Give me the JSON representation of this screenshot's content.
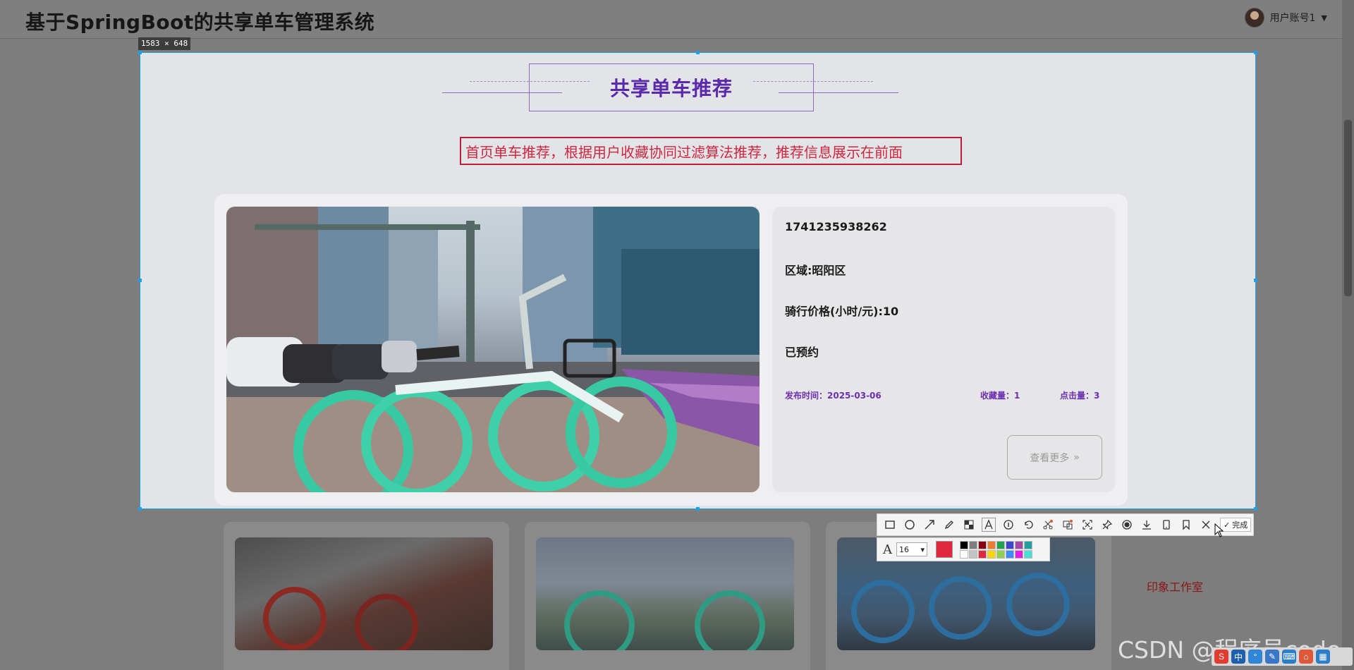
{
  "site": {
    "title": "基于SpringBoot的共享单车管理系统",
    "user_label": "用户账号1",
    "caret": "▼"
  },
  "capture": {
    "size_label": "1583 × 648"
  },
  "recommend": {
    "title": "共享单车推荐",
    "description": "首页单车推荐，根据用户收藏协同过滤算法推荐，推荐信息展示在前面"
  },
  "featured_bike": {
    "id": "1741235938262",
    "region": "区域:昭阳区",
    "price": "骑行价格(小时/元):10",
    "status": "已预约",
    "publish_time": "发布时间：2025-03-06",
    "favorites": "收藏量：1",
    "clicks": "点击量：3",
    "more_label": "查看更多",
    "more_arrow": "»"
  },
  "toolbar": {
    "tools": [
      "rectangle-icon",
      "ellipse-icon",
      "arrow-icon",
      "pencil-icon",
      "mosaic-icon",
      "text-icon",
      "number-marker-icon",
      "undo-icon",
      "cutout-icon",
      "translate-icon",
      "long-screenshot-icon",
      "pin-icon",
      "record-icon",
      "download-icon",
      "phone-icon",
      "bookmark-icon",
      "close-icon"
    ],
    "done_label": "完成",
    "font_size": "16",
    "selected_color": "#e0283e",
    "palette": [
      "#000000",
      "#7f7f7f",
      "#880015",
      "#ed7d31",
      "#22a150",
      "#3f48cc",
      "#a349a4",
      "#20a0a0",
      "#ffffff",
      "#c3c3c3",
      "#e0283e",
      "#ffd700",
      "#8fd14f",
      "#3d8bfd",
      "#e01fe0",
      "#44e0d8"
    ]
  },
  "background": {
    "studio": "印象工作室",
    "watermark": "CSDN @程序员code"
  }
}
